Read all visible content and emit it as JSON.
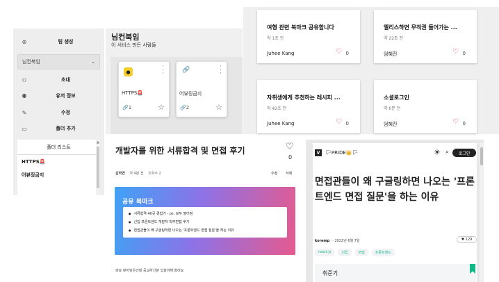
{
  "sidebar": {
    "create_team": {
      "icon": "plus-circle-icon",
      "label": "팀 생성"
    },
    "selected_team": "님컨북임",
    "menu": [
      {
        "icon": "add-user-icon",
        "label": "초대"
      },
      {
        "icon": "users-icon",
        "label": "유저 정보"
      },
      {
        "icon": "edit-icon",
        "label": "수정"
      },
      {
        "icon": "folder-icon",
        "label": "폴더 추가"
      }
    ],
    "folder_list_title": "폴더 리스트",
    "folders": [
      "HTTPS🚨",
      "어뷰징금지"
    ]
  },
  "folder_view": {
    "title": "님컨북임",
    "subtitle": "이 서비스 만든 사람들",
    "bookmarks": [
      {
        "name": "HTTPS🚨",
        "count": "1",
        "icon": "logo-icon"
      },
      {
        "name": "어뷰징금지",
        "count": "2",
        "icon": "link-icon"
      }
    ]
  },
  "bookmark_cards": [
    {
      "title": "여행 관련 북마크 공유합니다",
      "date": "약 1초 전",
      "author": "Juhee Kang",
      "likes": "0"
    },
    {
      "title": "엘리스하면 무적권 들어가는 ...",
      "date": "약 22초 전",
      "author": "엄혜진",
      "likes": "0"
    },
    {
      "title": "자취생에게 추천하는 레시피 ...",
      "date": "약 42초 전",
      "author": "Juhee Kang",
      "likes": "0"
    },
    {
      "title": "소셜로그인",
      "date": "약 6분 전",
      "author": "엄혜진",
      "likes": "0"
    }
  ],
  "article": {
    "title": "개발자를 위한 서류합격 및 면접 후기",
    "likes": "0",
    "author": "김하연",
    "date": "약 4분 전",
    "views": "조회수 2",
    "edit": "수정",
    "delete": "삭제",
    "shared_title": "공유 북마크",
    "shared_items": [
      "서류합격 40곳 경험기 - ps. 모두 떨어짐",
      "신입 프론트엔드 개발자 직무면접 후기",
      "면접관들이 왜 구글링하면 나오는 '프론트엔드 면접 질문'을 하는 이유"
    ],
    "footer": "파로 찾아놓은건데 공교하신분 있을까해 올려요"
  },
  "blog": {
    "logo": "V",
    "pride": "🏳PRIDE👑🏳",
    "login": "로그인",
    "title": "면접관들이 왜 구글링하면 나오는 '프론트엔드 면접 질문'을 하는 이유",
    "author": "koremp",
    "date": "2022년 6월 7일",
    "likes": "129",
    "tags": [
      "react.js",
      "신입",
      "면접",
      "프론트엔드"
    ],
    "series": "취준기"
  },
  "colors": {
    "heart": "#e23b55",
    "tag": "#12b886",
    "grad_start": "#3fa2f5",
    "grad_end": "#e55a8f"
  }
}
